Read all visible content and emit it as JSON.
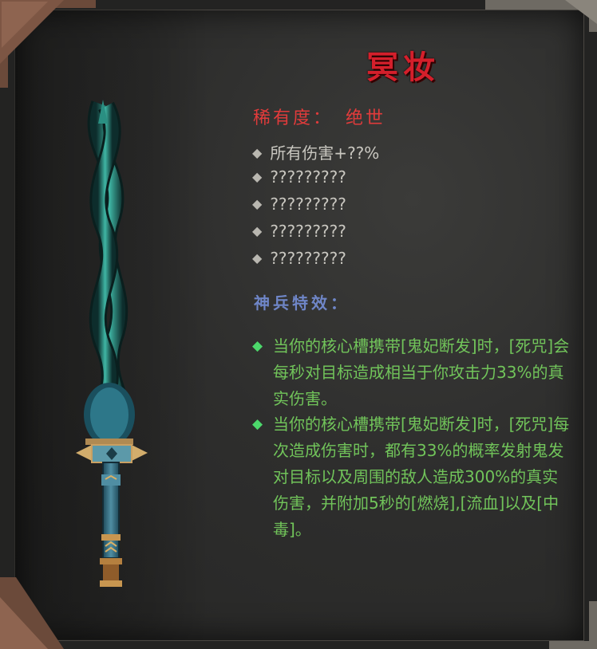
{
  "item": {
    "name": "冥妆",
    "rarity_label": "稀有度：",
    "rarity_value": "绝世"
  },
  "stats": [
    "所有伤害+??%",
    "?????????",
    "?????????",
    "?????????",
    "?????????"
  ],
  "special": {
    "title": "神兵特效：",
    "effects": [
      "当你的核心槽携带[鬼妃断发]时，[死咒]会每秒对目标造成相当于你攻击力33%的真实伤害。",
      "当你的核心槽携带[鬼妃断发]时，[死咒]每次造成伤害时，都有33%的概率发射鬼发对目标以及周围的敌人造成300%的真实伤害，并附加5秒的[燃烧],[流血]以及[中毒]。"
    ]
  },
  "colors": {
    "title": "#d41f2b",
    "rarity": "#e23b3b",
    "stat": "#c9c7c0",
    "special_title": "#6f86c8",
    "effect_text": "#71c45a",
    "effect_bullet": "#4cd86b"
  },
  "icons": {
    "stat_bullet": "diamond-bullet-icon",
    "effect_bullet": "green-diamond-bullet-icon",
    "weapon": "twisted-jade-sword-icon"
  }
}
